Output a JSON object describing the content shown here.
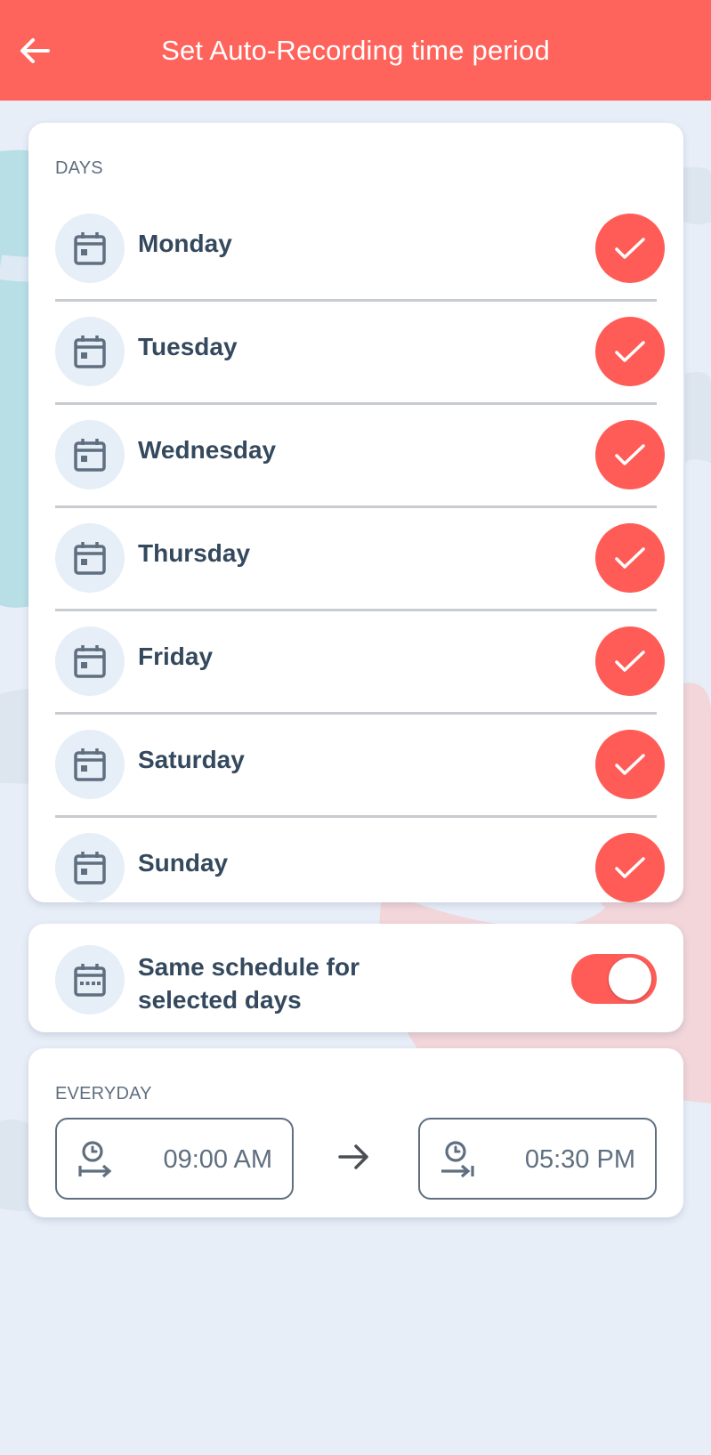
{
  "header": {
    "title": "Set Auto-Recording time period",
    "background_color": "#ff645c"
  },
  "days_section": {
    "label": "DAYS",
    "items": [
      {
        "label": "Monday",
        "checked": true
      },
      {
        "label": "Tuesday",
        "checked": true
      },
      {
        "label": "Wednesday",
        "checked": true
      },
      {
        "label": "Thursday",
        "checked": true
      },
      {
        "label": "Friday",
        "checked": true
      },
      {
        "label": "Saturday",
        "checked": true
      },
      {
        "label": "Sunday",
        "checked": true
      }
    ]
  },
  "schedule": {
    "label": "Same schedule for selected days",
    "enabled": true
  },
  "time_period": {
    "label": "EVERYDAY",
    "start": "09:00 AM",
    "end": "05:30 PM"
  },
  "colors": {
    "accent": "#ff5c57",
    "text": "#34495e",
    "muted": "#5f6f80",
    "background": "#e8eef8"
  }
}
